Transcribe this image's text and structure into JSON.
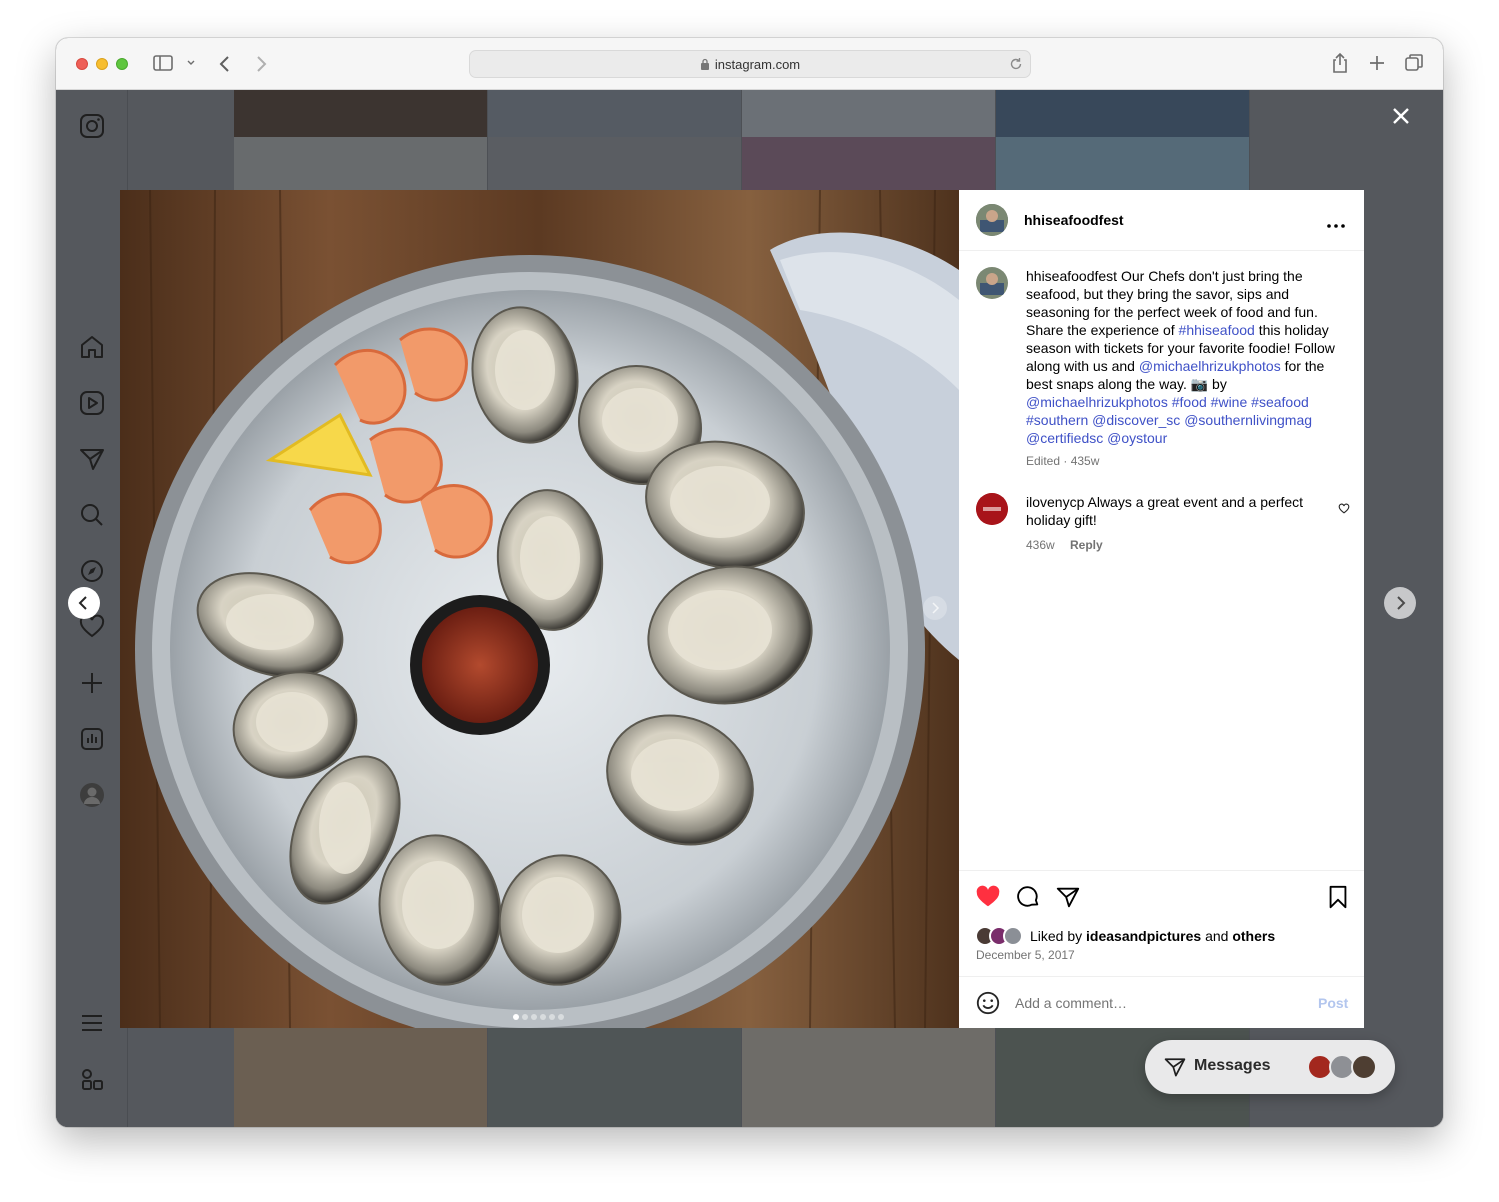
{
  "browser": {
    "url": "instagram.com"
  },
  "post": {
    "username": "hhiseafoodfest",
    "caption_user": "hhiseafoodfest",
    "caption_parts": [
      {
        "text": " Our Chefs don't just bring the seafood, but they bring the savor, sips and seasoning for the perfect week of food and fun. Share the experience of ",
        "link": false
      },
      {
        "text": "#hhiseafood",
        "link": true
      },
      {
        "text": " this holiday season with tickets for your favorite foodie! Follow along with us and ",
        "link": false
      },
      {
        "text": "@michaelhrizukphotos",
        "link": true
      },
      {
        "text": " for the best snaps along the way. 📷 by ",
        "link": false
      },
      {
        "text": "@michaelhrizukphotos",
        "link": true
      },
      {
        "text": " ",
        "link": false
      },
      {
        "text": "#food",
        "link": true
      },
      {
        "text": " ",
        "link": false
      },
      {
        "text": "#wine",
        "link": true
      },
      {
        "text": " ",
        "link": false
      },
      {
        "text": "#seafood",
        "link": true
      },
      {
        "text": " ",
        "link": false
      },
      {
        "text": "#southern",
        "link": true
      },
      {
        "text": " ",
        "link": false
      },
      {
        "text": "@discover_sc",
        "link": true
      },
      {
        "text": " ",
        "link": false
      },
      {
        "text": "@southernlivingmag",
        "link": true
      },
      {
        "text": " ",
        "link": false
      },
      {
        "text": "@certifiedsc",
        "link": true
      },
      {
        "text": " ",
        "link": false
      },
      {
        "text": "@oystour",
        "link": true
      }
    ],
    "caption_meta": "Edited · 435w",
    "comment": {
      "username": "ilovenycp",
      "text": " Always a great event and a perfect holiday gift!",
      "age": "436w",
      "reply_label": "Reply"
    },
    "liked_prefix": "Liked by ",
    "liked_user": "ideasandpictures",
    "liked_and": " and ",
    "liked_others": "others",
    "date": "December 5, 2017",
    "comment_placeholder": "Add a comment…",
    "post_label": "Post",
    "carousel": {
      "count": 6,
      "active": 1
    }
  },
  "messages": {
    "label": "Messages"
  },
  "icons": {
    "like": "heart-filled-icon",
    "comment": "comment-icon",
    "share": "paper-plane-icon",
    "save": "bookmark-icon",
    "emoji": "emoji-icon",
    "more": "more-icon",
    "close": "close-icon"
  },
  "colors": {
    "like_red": "#ff3040",
    "link_blue": "#3f51c7",
    "post_button": "#b3c6ee",
    "overlay": "#55585d"
  }
}
